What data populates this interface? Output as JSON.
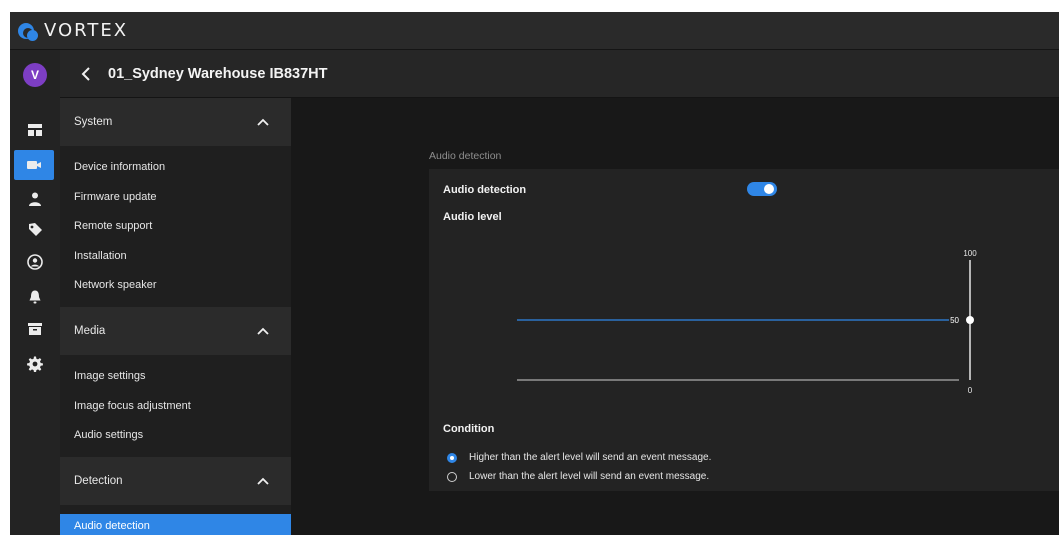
{
  "brand": {
    "name": "VORTEX"
  },
  "user": {
    "initial": "V"
  },
  "rail": {
    "items": [
      "dashboard-icon",
      "camera-icon",
      "user-icon",
      "tag-icon",
      "account-icon",
      "bell-icon",
      "archive-icon",
      "gear-icon"
    ],
    "active": "camera-icon"
  },
  "device": {
    "title": "01_Sydney Warehouse IB837HT"
  },
  "sidebar": {
    "system": {
      "label": "System",
      "items": [
        "Device information",
        "Firmware update",
        "Remote support",
        "Installation",
        "Network speaker"
      ]
    },
    "media": {
      "label": "Media",
      "items": [
        "Image settings",
        "Image focus adjustment",
        "Audio settings"
      ]
    },
    "detection": {
      "label": "Detection",
      "items": [
        "Audio detection"
      ]
    }
  },
  "main": {
    "caption": "Audio detection",
    "audio_detection_label": "Audio detection",
    "audio_detection_enabled": true,
    "audio_level_label": "Audio level",
    "slider": {
      "max_label": "100",
      "value_label": "50",
      "min_label": "0",
      "value": 50,
      "max": 100,
      "min": 0
    },
    "condition_label": "Condition",
    "conditions": [
      {
        "label": "Higher than the alert level will send an event message.",
        "selected": true
      },
      {
        "label": "Lower than the alert level will send an event message.",
        "selected": false
      }
    ]
  },
  "colors": {
    "accent": "#2f86e6",
    "avatar": "#7d3ec4"
  }
}
